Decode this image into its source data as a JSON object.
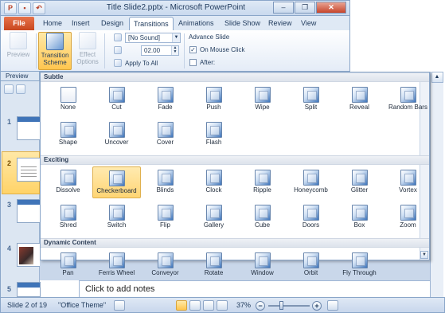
{
  "window": {
    "title": "Title Slide2.pptx - Microsoft PowerPoint",
    "controls": {
      "minimize": "–",
      "restore": "❐",
      "close": "✕"
    }
  },
  "tabs": [
    {
      "label": "File"
    },
    {
      "label": "Home"
    },
    {
      "label": "Insert"
    },
    {
      "label": "Design"
    },
    {
      "label": "Transitions"
    },
    {
      "label": "Animations"
    },
    {
      "label": "Slide Show"
    },
    {
      "label": "Review"
    },
    {
      "label": "View"
    }
  ],
  "ribbon": {
    "preview_label": "Preview",
    "transition_scheme_label": "Transition Scheme",
    "effect_options_label": "Effect Options",
    "sound_value": "[No Sound]",
    "duration_value": "02.00",
    "apply_to_all_label": "Apply To All",
    "advance_slide_label": "Advance Slide",
    "on_mouse_click_label": "On Mouse Click",
    "on_mouse_click_checked": true,
    "after_label": "After:",
    "after_checked": false,
    "group_label": "Preview"
  },
  "gallery": {
    "sections": [
      {
        "title": "Subtle",
        "items": [
          "None",
          "Cut",
          "Fade",
          "Push",
          "Wipe",
          "Split",
          "Reveal",
          "Random Bars",
          "Shape",
          "Uncover",
          "Cover",
          "Flash"
        ]
      },
      {
        "title": "Exciting",
        "items": [
          "Dissolve",
          "Checkerboard",
          "Blinds",
          "Clock",
          "Ripple",
          "Honeycomb",
          "Glitter",
          "Vortex",
          "Shred",
          "Switch",
          "Flip",
          "Gallery",
          "Cube",
          "Doors",
          "Box",
          "Zoom"
        ]
      },
      {
        "title": "Dynamic Content",
        "items": [
          "Pan",
          "Ferris Wheel",
          "Conveyor",
          "Rotate",
          "Window",
          "Orbit",
          "Fly Through"
        ]
      }
    ],
    "selected_item": "Checkerboard"
  },
  "slides_pane": {
    "slide_numbers": [
      "1",
      "2",
      "3",
      "4",
      "5"
    ],
    "selected_slide": "2"
  },
  "notes": {
    "placeholder": "Click to add notes"
  },
  "statusbar": {
    "slide_info": "Slide 2 of 19",
    "theme": "\"Office Theme\"",
    "zoom": "37%",
    "zoom_fraction": 0.37
  }
}
